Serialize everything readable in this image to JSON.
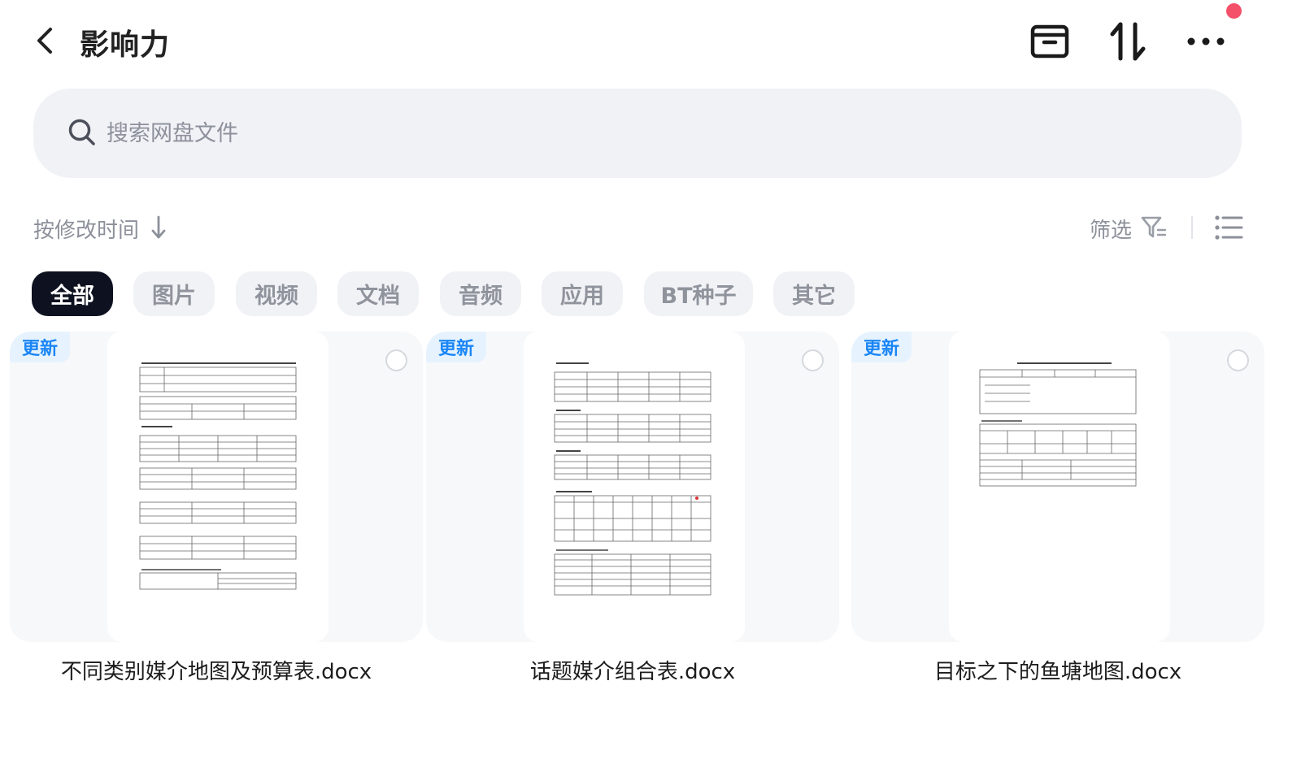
{
  "header": {
    "title": "影响力"
  },
  "search": {
    "placeholder": "搜索网盘文件"
  },
  "toolbar": {
    "sort_label": "按修改时间",
    "filter_label": "筛选"
  },
  "chips": [
    {
      "label": "全部",
      "active": true
    },
    {
      "label": "图片",
      "active": false
    },
    {
      "label": "视频",
      "active": false
    },
    {
      "label": "文档",
      "active": false
    },
    {
      "label": "音频",
      "active": false
    },
    {
      "label": "应用",
      "active": false
    },
    {
      "label": "BT种子",
      "active": false
    },
    {
      "label": "其它",
      "active": false
    }
  ],
  "files": [
    {
      "name": "不同类别媒介地图及预算表.docx",
      "badge": "更新",
      "selected": false
    },
    {
      "name": "话题媒介组合表.docx",
      "badge": "更新",
      "selected": false
    },
    {
      "name": "目标之下的鱼塘地图.docx",
      "badge": "更新",
      "selected": false
    }
  ],
  "colors": {
    "accent_badge": "#1b86f5",
    "notification_dot": "#f5506a",
    "active_chip": "#0e1220"
  }
}
